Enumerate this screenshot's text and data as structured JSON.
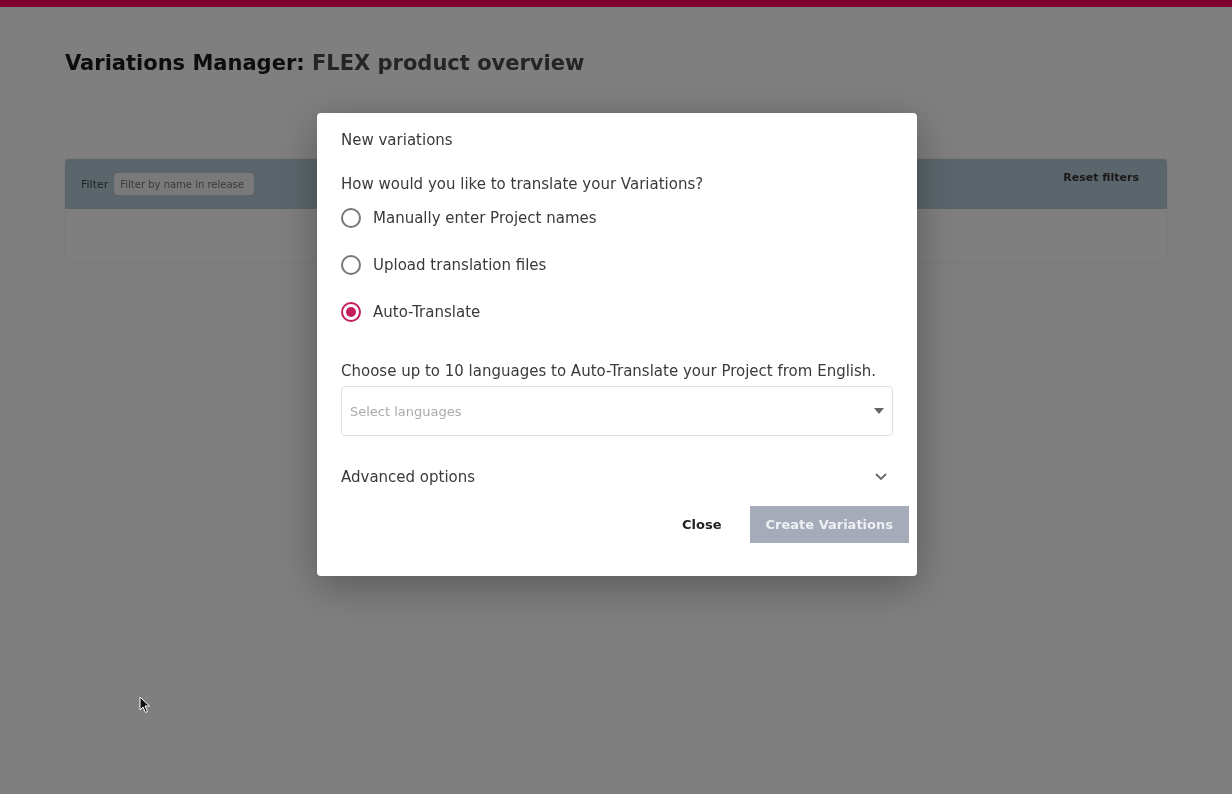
{
  "page": {
    "title": "Variations Manager:",
    "subtitle": "FLEX product overview"
  },
  "filter_bar": {
    "label": "Filter",
    "placeholder": "Filter by name in release",
    "reset": "Reset filters"
  },
  "dialog": {
    "title": "New variations",
    "question": "How would you like to translate your Variations?",
    "options": [
      {
        "label": "Manually enter Project names",
        "selected": false
      },
      {
        "label": "Upload translation files",
        "selected": false
      },
      {
        "label": "Auto-Translate",
        "selected": true
      }
    ],
    "languages_hint": "Choose up to 10 languages to Auto-Translate your Project from English.",
    "languages_placeholder": "Select languages",
    "advanced": {
      "label": "Advanced options",
      "expanded": false
    },
    "buttons": [
      {
        "label": "Close",
        "kind": "text",
        "disabled": false
      },
      {
        "label": "Create Variations",
        "kind": "primary",
        "disabled": true
      }
    ]
  }
}
